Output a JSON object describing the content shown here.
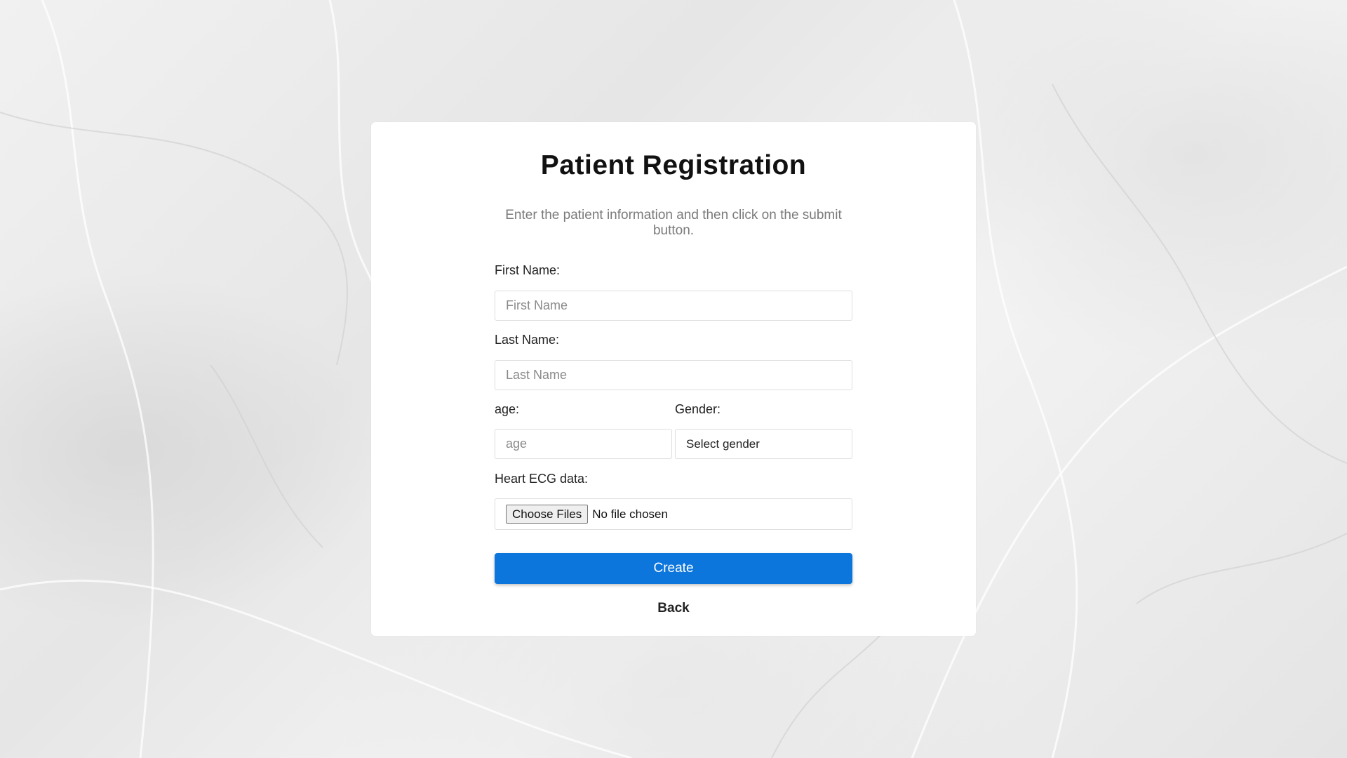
{
  "form": {
    "title": "Patient Registration",
    "subtitle": "Enter the patient information and then click on the submit button.",
    "first_name": {
      "label": "First Name:",
      "placeholder": "First Name"
    },
    "last_name": {
      "label": "Last Name:",
      "placeholder": "Last Name"
    },
    "age": {
      "label": "age:",
      "placeholder": "age"
    },
    "gender": {
      "label": "Gender:",
      "selected": "Select gender"
    },
    "ecg": {
      "label": "Heart ECG data:",
      "button": "Choose Files",
      "status": "No file chosen"
    },
    "create_label": "Create",
    "back_label": "Back"
  },
  "colors": {
    "primary_button": "#0c76dd",
    "card_background": "#ffffff",
    "page_background": "#ececec"
  }
}
